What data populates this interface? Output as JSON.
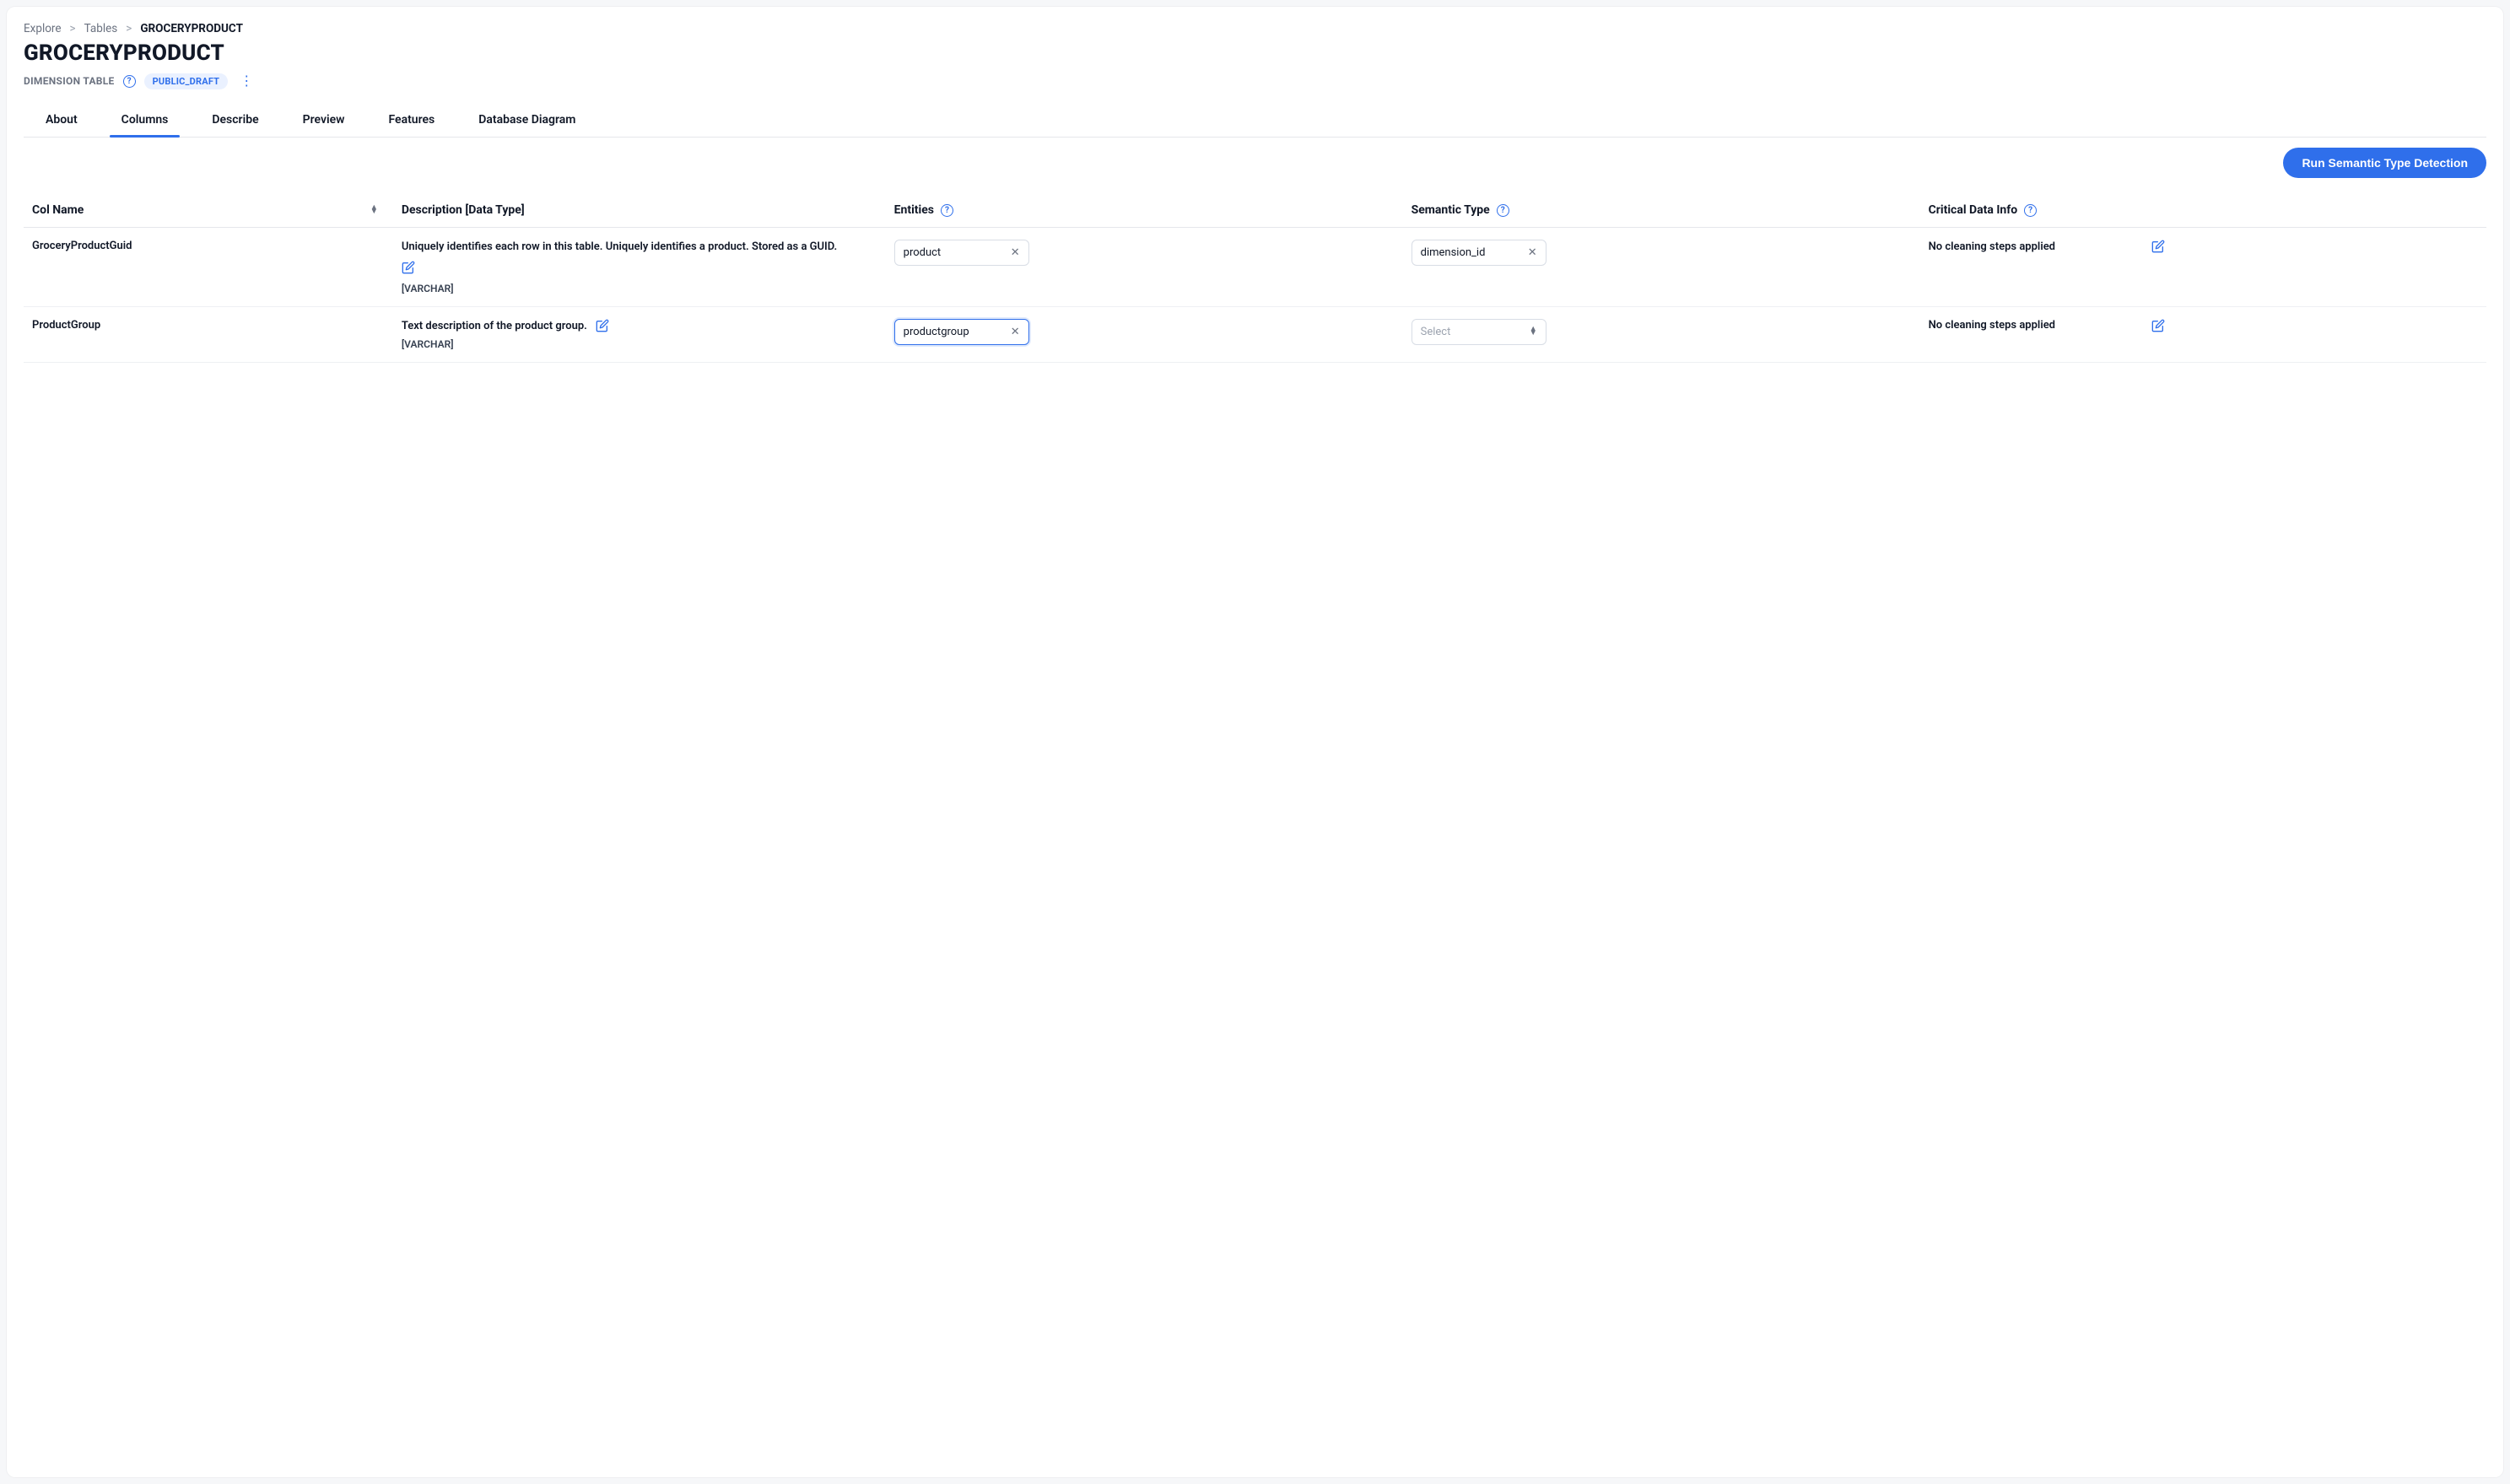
{
  "breadcrumb": {
    "items": [
      "Explore",
      "Tables"
    ],
    "current": "GROCERYPRODUCT"
  },
  "header": {
    "title": "GROCERYPRODUCT",
    "subtitle": "DIMENSION TABLE",
    "badge": "PUBLIC_DRAFT"
  },
  "tabs": [
    {
      "label": "About",
      "active": false
    },
    {
      "label": "Columns",
      "active": true
    },
    {
      "label": "Describe",
      "active": false
    },
    {
      "label": "Preview",
      "active": false
    },
    {
      "label": "Features",
      "active": false
    },
    {
      "label": "Database Diagram",
      "active": false
    }
  ],
  "toolbar": {
    "run_detection_label": "Run Semantic Type Detection"
  },
  "table": {
    "headers": {
      "colname": "Col Name",
      "description": "Description [Data Type]",
      "entities": "Entities",
      "semtype": "Semantic Type",
      "cdi": "Critical Data Info"
    },
    "rows": [
      {
        "name": "GroceryProductGuid",
        "description": "Uniquely identifies each row in this table. Uniquely identifies a product. Stored as a GUID.",
        "datatype": "[VARCHAR]",
        "entity": "product",
        "semtype": "dimension_id",
        "semtype_placeholder": "",
        "cdi": "No cleaning steps applied",
        "desc_inline_edit": false,
        "entity_focused": false,
        "semtype_is_select": false
      },
      {
        "name": "ProductGroup",
        "description": "Text description of the product group.",
        "datatype": "[VARCHAR]",
        "entity": "productgroup",
        "semtype": "",
        "semtype_placeholder": "Select",
        "cdi": "No cleaning steps applied",
        "desc_inline_edit": true,
        "entity_focused": true,
        "semtype_is_select": true
      }
    ]
  }
}
